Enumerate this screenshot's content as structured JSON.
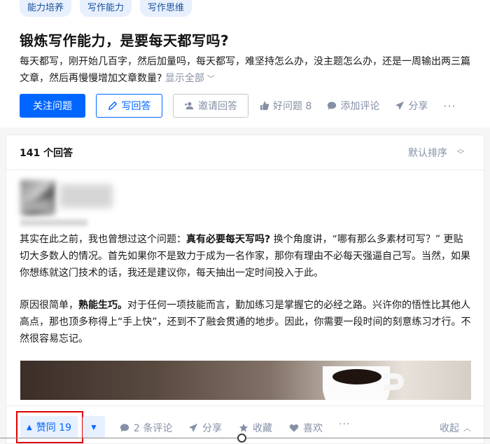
{
  "question": {
    "tags": [
      "能力培养",
      "写作能力",
      "写作思维"
    ],
    "title": "锻炼写作能力，是要每天都写吗?",
    "description": "每天都写，刚开始几百字，然后加量吗，每天都写，难坚持怎么办，没主题怎么办，还是一周输出两三篇文章，然后再慢慢增加文章数量?",
    "show_all": "显示全部",
    "actions": {
      "follow": "关注问题",
      "write": "写回答",
      "invite": "邀请回答",
      "good_question": "好问题 8",
      "add_comment": "添加评论",
      "share": "分享",
      "more": "···"
    }
  },
  "answers": {
    "count": "141 个回答",
    "sort": "默认排序",
    "answer": {
      "p1_a": "其实在此之前，我也曾想过这个问题：",
      "p1_bold": "真有必要每天写吗?",
      "p1_b": " 换个角度讲，“哪有那么多素材可写？” 更贴切大多数人的情况。首先如果你不是致力于成为一名作家，那你有理由不必每天强逼自己写。当然，如果你想练就这门技术的话，我还是建议你，每天抽出一定时间投入于此。",
      "p2_a": "原因很简单，",
      "p2_bold": "熟能生巧。",
      "p2_b": "对于任何一项技能而言，勤加练习是掌握它的必经之路。兴许你的悟性比其他人高点，那也顶多称得上“手上快”，还到不了融会贯通的地步。因此，你需要一段时间的刻意练习才行。不然很容易忘记。"
    },
    "action_bar": {
      "vote_up": "赞同 19",
      "comments": "2 条评论",
      "share": "分享",
      "favorite": "收藏",
      "like": "喜欢",
      "more": "···",
      "collapse": "收起"
    }
  },
  "colors": {
    "primary": "#0066ff",
    "muted": "#8590a6",
    "highlight": "#e00000"
  }
}
